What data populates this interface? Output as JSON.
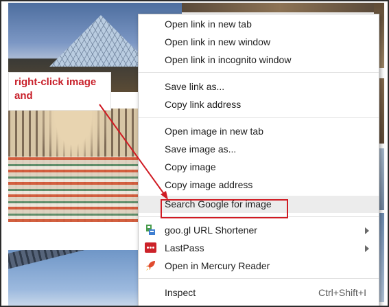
{
  "annotation": {
    "line1": "right-click image",
    "line2": "and"
  },
  "menu": {
    "items": [
      {
        "label": "Open link in new tab"
      },
      {
        "label": "Open link in new window"
      },
      {
        "label": "Open link in incognito window"
      },
      {
        "label": "Save link as..."
      },
      {
        "label": "Copy link address"
      },
      {
        "label": "Open image in new tab"
      },
      {
        "label": "Save image as..."
      },
      {
        "label": "Copy image"
      },
      {
        "label": "Copy image address"
      },
      {
        "label": "Search Google for image"
      },
      {
        "label": "goo.gl URL Shortener",
        "icon": "goo-gl-shortener-icon",
        "submenu": true
      },
      {
        "label": "LastPass",
        "icon": "lastpass-icon",
        "submenu": true
      },
      {
        "label": "Open in Mercury Reader",
        "icon": "mercury-reader-rocket-icon"
      },
      {
        "label": "Inspect",
        "shortcut": "Ctrl+Shift+I"
      }
    ]
  },
  "colors": {
    "annotation_text": "#c8202a",
    "highlight_border": "#d01b23",
    "arrow": "#d01b23",
    "menu_hover": "#ececec"
  },
  "icons": {
    "lastpass": "lastpass-icon",
    "goo_gl": "goo-gl-shortener-icon",
    "mercury": "mercury-reader-rocket-icon"
  }
}
